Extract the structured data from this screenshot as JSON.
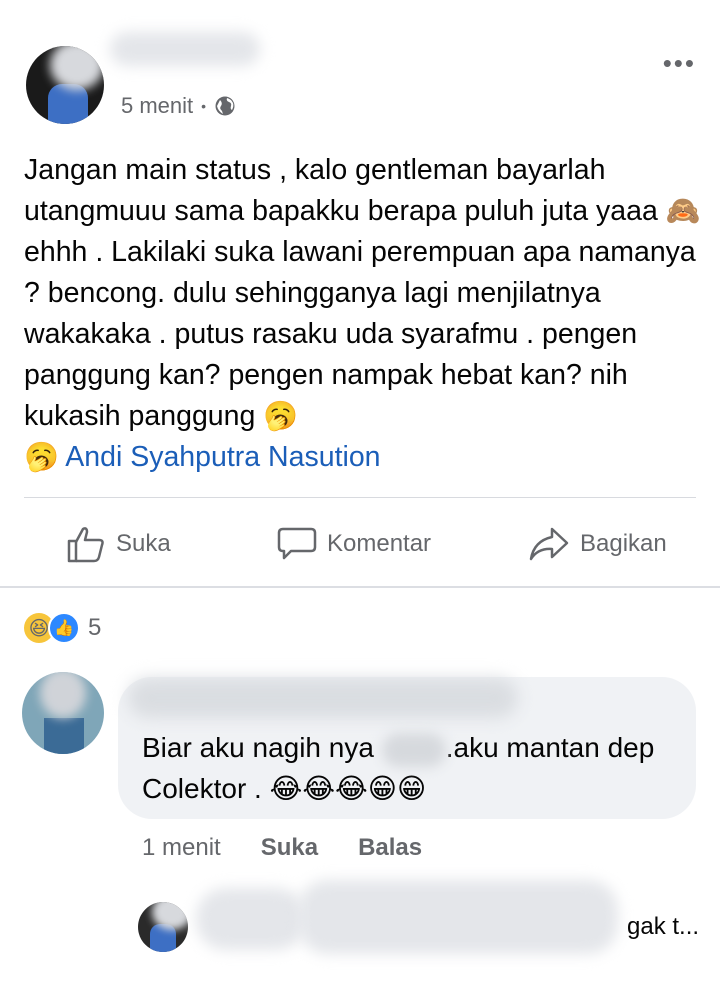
{
  "post": {
    "time": "5 menit",
    "separator": "•",
    "visibility_icon": "globe-icon",
    "more_icon": "more-icon",
    "body": {
      "part1": "Jangan main status , kalo gentleman bayarlah utangmuuu sama bapakku berapa puluh juta yaaa ",
      "emoji_monkey": "🙈",
      "part2": " ehhh . Lakilaki suka lawani perempuan apa namanya ? bencong. dulu sehingganya lagi menjilatnya wakakaka .  putus rasaku uda syarafmu . pengen panggung kan? pengen nampak hebat kan? nih kukasih panggung ",
      "emoji_yawn1": "🥱",
      "emoji_yawn2": "🥱",
      "tagged_name": "Andi Syahputra Nasution"
    }
  },
  "actions": {
    "like_label": "Suka",
    "comment_label": "Komentar",
    "share_label": "Bagikan"
  },
  "reactions": {
    "haha_icon": "😆",
    "like_icon": "👍",
    "count": "5"
  },
  "comment": {
    "text_part1": "Biar aku nagih nya ",
    "text_part2": ".aku mantan dep Colektor . ",
    "emojis": "😂😂😂😁😁",
    "time": "1 menit",
    "like_label": "Suka",
    "reply_label": "Balas"
  },
  "reply": {
    "visible_text": "gak t..."
  },
  "colors": {
    "tag_link": "#1b5eb8",
    "meta_gray": "#65676b",
    "bubble_bg": "#f0f2f5"
  }
}
